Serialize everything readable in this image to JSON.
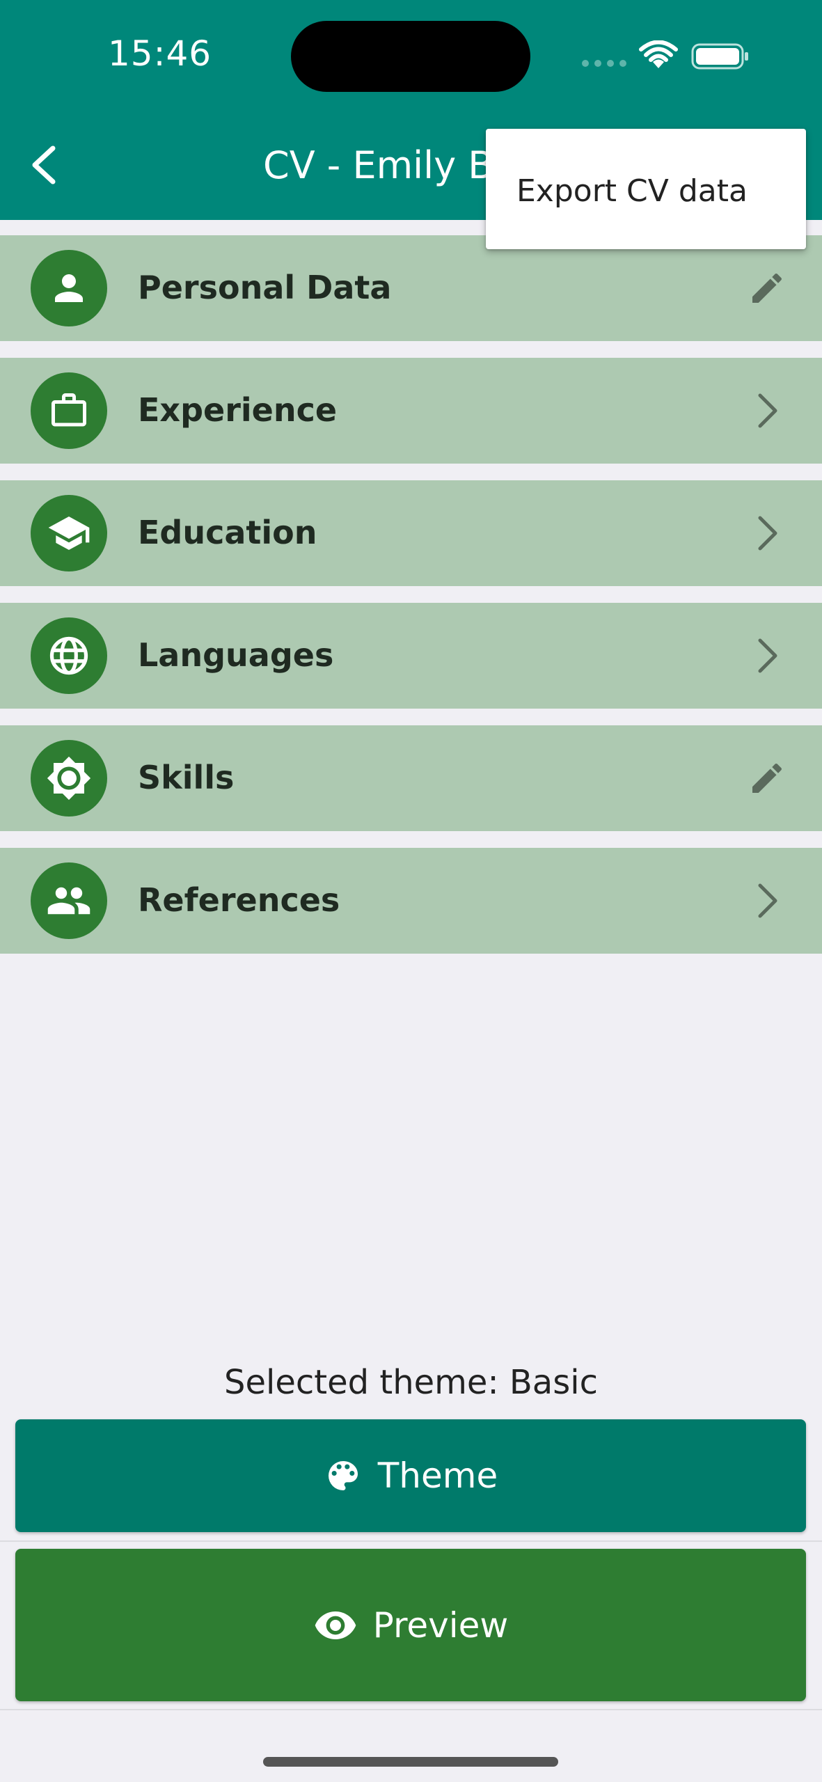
{
  "status_bar": {
    "time": "15:46"
  },
  "app_bar": {
    "title": "CV - Emily B",
    "back_icon": "chevron-left-icon"
  },
  "popup_menu": {
    "items": [
      {
        "label": "Export CV data"
      }
    ]
  },
  "sections": [
    {
      "label": "Personal Data",
      "icon": "person-icon",
      "action": "edit-icon"
    },
    {
      "label": "Experience",
      "icon": "briefcase-icon",
      "action": "chevron-right-icon"
    },
    {
      "label": "Education",
      "icon": "graduation-cap-icon",
      "action": "chevron-right-icon"
    },
    {
      "label": "Languages",
      "icon": "globe-icon",
      "action": "chevron-right-icon"
    },
    {
      "label": "Skills",
      "icon": "brightness-icon",
      "action": "edit-icon"
    },
    {
      "label": "References",
      "icon": "people-icon",
      "action": "chevron-right-icon"
    }
  ],
  "footer": {
    "selected_theme_label": "Selected theme: Basic",
    "theme_button": {
      "label": "Theme",
      "icon": "palette-icon"
    },
    "preview_button": {
      "label": "Preview",
      "icon": "eye-icon"
    }
  },
  "colors": {
    "primary": "#00877a",
    "row_background": "#adc9b1",
    "icon_circle": "#2e7d32",
    "theme_button": "#007a6a",
    "preview_button": "#2e7d32",
    "page_background": "#f0eff4"
  }
}
